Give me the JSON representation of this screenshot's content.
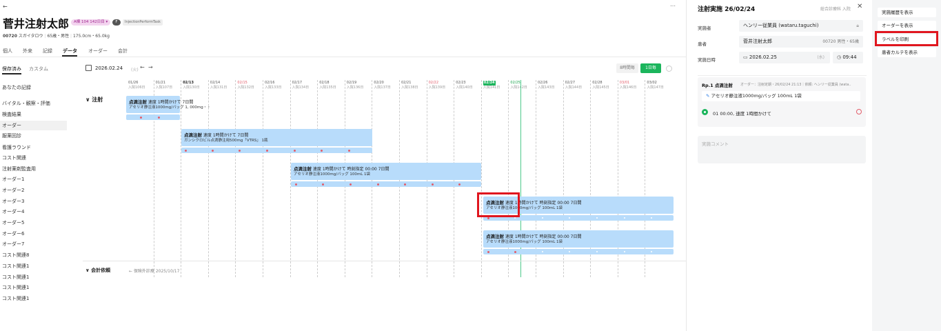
{
  "header": {
    "back_icon": "arrow-left-icon",
    "patient_name": "菅井注射太郎",
    "ward_badge": "A棟 104 142日目",
    "gender_badge": "F",
    "task_badge": "InjectionPerformTask",
    "patient_id": "00720",
    "patient_kana": "スガイタロウ",
    "age_gender": "65歳・男性",
    "body": "175.0cm・65.0kg",
    "more_icon": "more-icon"
  },
  "tabs": [
    "個人",
    "外来",
    "記録",
    "データ",
    "オーダー",
    "会計"
  ],
  "active_tab": "データ",
  "left_nav": {
    "saved_tab": "保存済み",
    "custom_tab": "カスタム",
    "items": [
      "あなたの記録",
      "バイタル・観察・評価",
      "検査結果",
      "オーダー",
      "服薬回診",
      "看護ラウンド",
      "コスト関連",
      "注射薬剤監査用",
      "オーダー1",
      "オーダー2",
      "オーダー3",
      "オーダー4",
      "オーダー5",
      "オーダー6",
      "オーダー7",
      "コスト関連8",
      "コスト関連1",
      "コスト関連1",
      "コスト関連1",
      "コスト関連1"
    ],
    "active": "オーダー"
  },
  "toolbar": {
    "date": "2026.02.24",
    "date_hint": "(火)",
    "view_8h": "8時間毎",
    "view_1d": "1日毎"
  },
  "dates": [
    {
      "d": "01/26",
      "s": "入院106日",
      "c": "#555"
    },
    {
      "d": "01/21",
      "s": "入院107日",
      "c": "#555"
    },
    {
      "d": "02/13",
      "s": "入院130日",
      "c": "#555"
    },
    {
      "d": "02/14",
      "s": "入院131日",
      "c": "#555"
    },
    {
      "d": "02/15",
      "s": "入院132日",
      "c": "#e35d6a"
    },
    {
      "d": "02/16",
      "s": "入院133日",
      "c": "#555"
    },
    {
      "d": "02/17",
      "s": "入院134日",
      "c": "#555"
    },
    {
      "d": "02/18",
      "s": "入院135日",
      "c": "#555"
    },
    {
      "d": "02/19",
      "s": "入院136日",
      "c": "#555"
    },
    {
      "d": "02/20",
      "s": "入院137日",
      "c": "#555"
    },
    {
      "d": "02/21",
      "s": "入院138日",
      "c": "#555"
    },
    {
      "d": "02/22",
      "s": "入院139日",
      "c": "#e35d6a"
    },
    {
      "d": "02/23",
      "s": "入院140日",
      "c": "#555"
    },
    {
      "d": "02/24",
      "s": "入院141日",
      "c": "#fff"
    },
    {
      "d": "02/25",
      "s": "入院142日",
      "c": "#16a34a"
    },
    {
      "d": "02/26",
      "s": "入院143日",
      "c": "#555"
    },
    {
      "d": "02/27",
      "s": "入院144日",
      "c": "#555"
    },
    {
      "d": "02/28",
      "s": "入院145日",
      "c": "#555"
    },
    {
      "d": "03/01",
      "s": "入院146日",
      "c": "#e35d6a"
    },
    {
      "d": "03/02",
      "s": "入院147日",
      "c": "#555"
    }
  ],
  "section_injection": "注射",
  "section_billing": "会計依頼",
  "billing_item": "← 保険外診療 2025/10/17",
  "bars": [
    {
      "title": "点滴注射",
      "sub": "速度 1時間かけて 7日間",
      "drug": "アセリオ静注液1000mg/バッグ 1, 000mg・・"
    },
    {
      "title": "点滴注射",
      "sub": "速度 1時間かけて 7日間",
      "drug": "ガンシクロビル点滴静注用500mg「VTRS」 1瓶"
    },
    {
      "title": "点滴注射",
      "sub": "速度 1時間かけて 時刻指定 00:00 7日間",
      "drug": "アセリオ静注液1000mg/バッグ 100mL 1袋"
    },
    {
      "title": "点滴注射",
      "sub": "速度 1時間かけて 時刻指定 00:00 7日間",
      "drug": "アセリオ静注液1000mg/バッグ 100mL 1袋"
    },
    {
      "title": "点滴注射",
      "sub": "速度 1時間かけて 時刻指定 00:00 7日間",
      "drug": "アセリオ静注液1000mg/バッグ 100mL 1袋"
    }
  ],
  "panel": {
    "title": "注射実施 26/02/24",
    "links": "総合診療科 入院",
    "performer_label": "実施者",
    "performer": "ヘンリー従業員 (wataru.taguchi)",
    "patient_label": "患者",
    "patient": "菅井注射太郎",
    "patient_meta": "00720 男性・65歳",
    "datetime_label": "実施日時",
    "date": "2026.02.25",
    "weekday": "(水)",
    "time": "09:44",
    "rp_title": "Rp.1 点滴注射",
    "rp_meta": "オーダー：注射定期・26/02/24 21:13｜依頼: ヘンリー従業員 (wata..",
    "drug": "アセリオ静注液1000mg/バッグ 100mL 1袋",
    "timing": "01 00:00, 速度 1時間かけて",
    "comment_placeholder": "実施コメント"
  },
  "menu": [
    "実施履歴を表示",
    "オーダーを表示",
    "ラベルを印刷",
    "患者カルテを表示"
  ],
  "colors": {
    "accent": "#1bb55c",
    "bar": "#b8dcfb",
    "highlight": "#e0161e"
  }
}
